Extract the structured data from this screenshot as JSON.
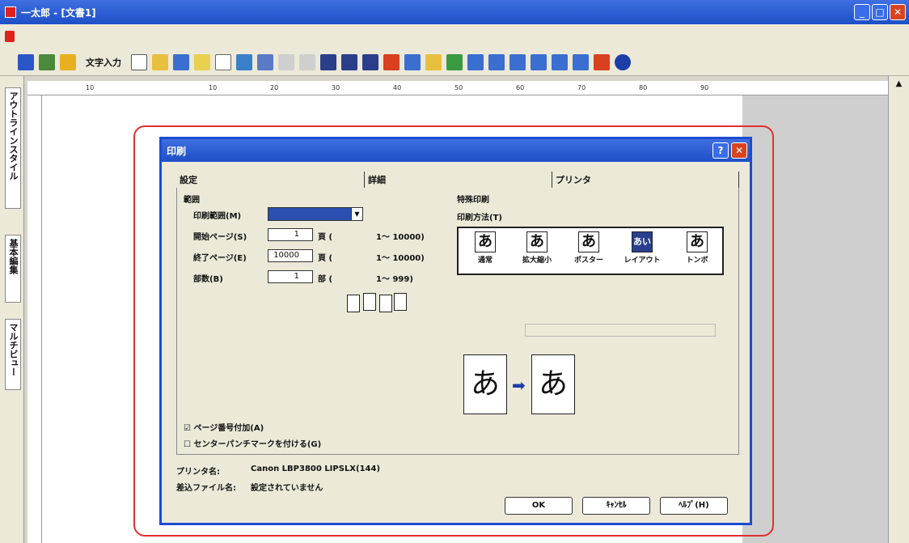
{
  "window": {
    "title": "一太郎 - [文書1]"
  },
  "toolbar": {
    "text_input_label": "文字入力"
  },
  "sidebar": {
    "tabs": [
      "アウトラインスタイル",
      "基本編集",
      "マルチビュー"
    ]
  },
  "ruler": {
    "ticks": [
      "10",
      "10",
      "20",
      "30",
      "40",
      "50",
      "60",
      "70",
      "80",
      "90"
    ]
  },
  "dialog": {
    "title": "印刷",
    "tabs": [
      "設定",
      "詳細",
      "プリンタ"
    ],
    "range": {
      "group_label": "範囲",
      "print_range_label": "印刷範囲(M)",
      "start_page_label": "開始ページ(S)",
      "start_page_value": "1",
      "start_page_unit": "頁 (",
      "start_page_range": "1～ 10000)",
      "end_page_label": "終了ページ(E)",
      "end_page_value": "10000",
      "end_page_unit": "頁 (",
      "end_page_range": "1～ 10000)",
      "copies_label": "部数(B)",
      "copies_value": "1",
      "copies_unit": "部 (",
      "copies_range": "1～   999)"
    },
    "special": {
      "group_label": "特殊印刷",
      "method_label": "印刷方法(T)",
      "methods": [
        {
          "glyph": "あ",
          "label": "通常"
        },
        {
          "glyph": "あ",
          "label": "拡大縮小"
        },
        {
          "glyph": "あ",
          "label": "ポスター"
        },
        {
          "glyph": "あい",
          "label": "レイアウト"
        },
        {
          "glyph": "あ",
          "label": "トンボ"
        }
      ],
      "preview_glyph": "あ"
    },
    "page_number": {
      "label": "ページ番号付加(A)",
      "checked": true
    },
    "center_punch": {
      "label": "センターパンチマークを付ける(G)",
      "checked": false
    },
    "printer_name_label": "プリンタ名:",
    "printer_name_value": "Canon LBP3800 LIPSLX(144)",
    "overlay_file_label": "差込ファイル名:",
    "overlay_file_value": "設定されていません",
    "buttons": {
      "ok": "OK",
      "cancel": "ｷｬﾝｾﾙ",
      "help": "ﾍﾙﾌﾟ(H)"
    }
  }
}
